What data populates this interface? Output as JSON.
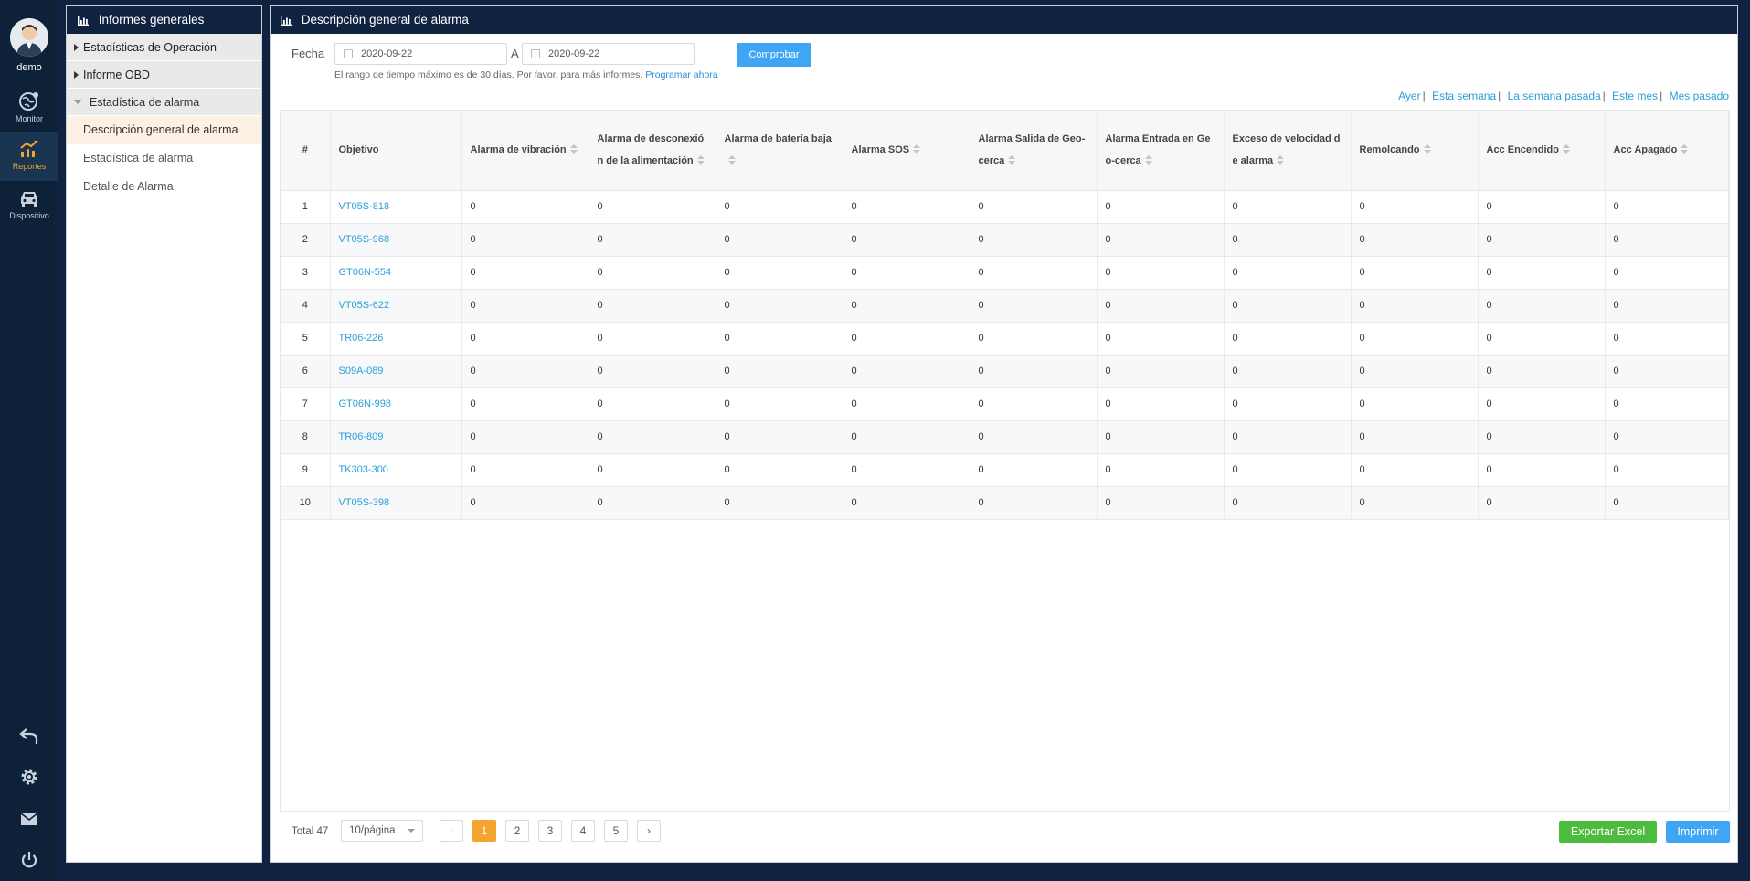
{
  "rail": {
    "user": "demo",
    "items": [
      {
        "label": "Monitor",
        "icon": "globe-icon"
      },
      {
        "label": "Reportes",
        "icon": "chart-icon"
      },
      {
        "label": "Dispositivo",
        "icon": "car-icon"
      }
    ],
    "bottom_icons": [
      "undo-icon",
      "gear-icon",
      "mail-icon",
      "power-icon"
    ]
  },
  "sidebar": {
    "title": "Informes generales",
    "groups": [
      {
        "label": "Estadísticas de Operación"
      },
      {
        "label": "Informe OBD"
      },
      {
        "label": "Estadística de alarma"
      }
    ],
    "items": [
      {
        "label": "Descripción general de alarma"
      },
      {
        "label": "Estadística de alarma"
      },
      {
        "label": "Detalle de Alarma"
      }
    ]
  },
  "main": {
    "title": "Descripción general de alarma",
    "filter": {
      "date_label": "Fecha",
      "from": "2020-09-22",
      "to_label": "A",
      "to": "2020-09-22",
      "check_button": "Comprobar",
      "hint": "El rango de tiempo máximo es de 30 días. Por favor, para más informes.",
      "hint_link": "Programar ahora"
    },
    "quick_ranges": [
      "Ayer",
      "Esta semana",
      "La semana pasada",
      "Este mes",
      "Mes pasado"
    ],
    "table": {
      "headers": [
        "#",
        "Objetivo",
        "Alarma de vibración",
        "Alarma de desconexión de la alimentación",
        "Alarma de batería baja",
        "Alarma SOS",
        "Alarma Salida de Geo-cerca",
        "Alarma Entrada en Geo-cerca",
        "Exceso de velocidad de alarma",
        "Remolcando",
        "Acc Encendido",
        "Acc Apagado"
      ],
      "rows": [
        [
          "1",
          "VT05S-818",
          "0",
          "0",
          "0",
          "0",
          "0",
          "0",
          "0",
          "0",
          "0",
          "0"
        ],
        [
          "2",
          "VT05S-968",
          "0",
          "0",
          "0",
          "0",
          "0",
          "0",
          "0",
          "0",
          "0",
          "0"
        ],
        [
          "3",
          "GT06N-554",
          "0",
          "0",
          "0",
          "0",
          "0",
          "0",
          "0",
          "0",
          "0",
          "0"
        ],
        [
          "4",
          "VT05S-622",
          "0",
          "0",
          "0",
          "0",
          "0",
          "0",
          "0",
          "0",
          "0",
          "0"
        ],
        [
          "5",
          "TR06-226",
          "0",
          "0",
          "0",
          "0",
          "0",
          "0",
          "0",
          "0",
          "0",
          "0"
        ],
        [
          "6",
          "S09A-089",
          "0",
          "0",
          "0",
          "0",
          "0",
          "0",
          "0",
          "0",
          "0",
          "0"
        ],
        [
          "7",
          "GT06N-998",
          "0",
          "0",
          "0",
          "0",
          "0",
          "0",
          "0",
          "0",
          "0",
          "0"
        ],
        [
          "8",
          "TR06-809",
          "0",
          "0",
          "0",
          "0",
          "0",
          "0",
          "0",
          "0",
          "0",
          "0"
        ],
        [
          "9",
          "TK303-300",
          "0",
          "0",
          "0",
          "0",
          "0",
          "0",
          "0",
          "0",
          "0",
          "0"
        ],
        [
          "10",
          "VT05S-398",
          "0",
          "0",
          "0",
          "0",
          "0",
          "0",
          "0",
          "0",
          "0",
          "0"
        ]
      ]
    },
    "footer": {
      "total": "Total 47",
      "per_page": "10/página",
      "pages": [
        "1",
        "2",
        "3",
        "4",
        "5"
      ],
      "current_page": "1",
      "export_button": "Exportar Excel",
      "print_button": "Imprimir"
    }
  },
  "colors": {
    "navy": "#0f2340",
    "accent_orange": "#f5a32f",
    "link_blue": "#2a9fd8",
    "button_blue": "#3ea6f5",
    "export_green": "#4dbb3d"
  }
}
